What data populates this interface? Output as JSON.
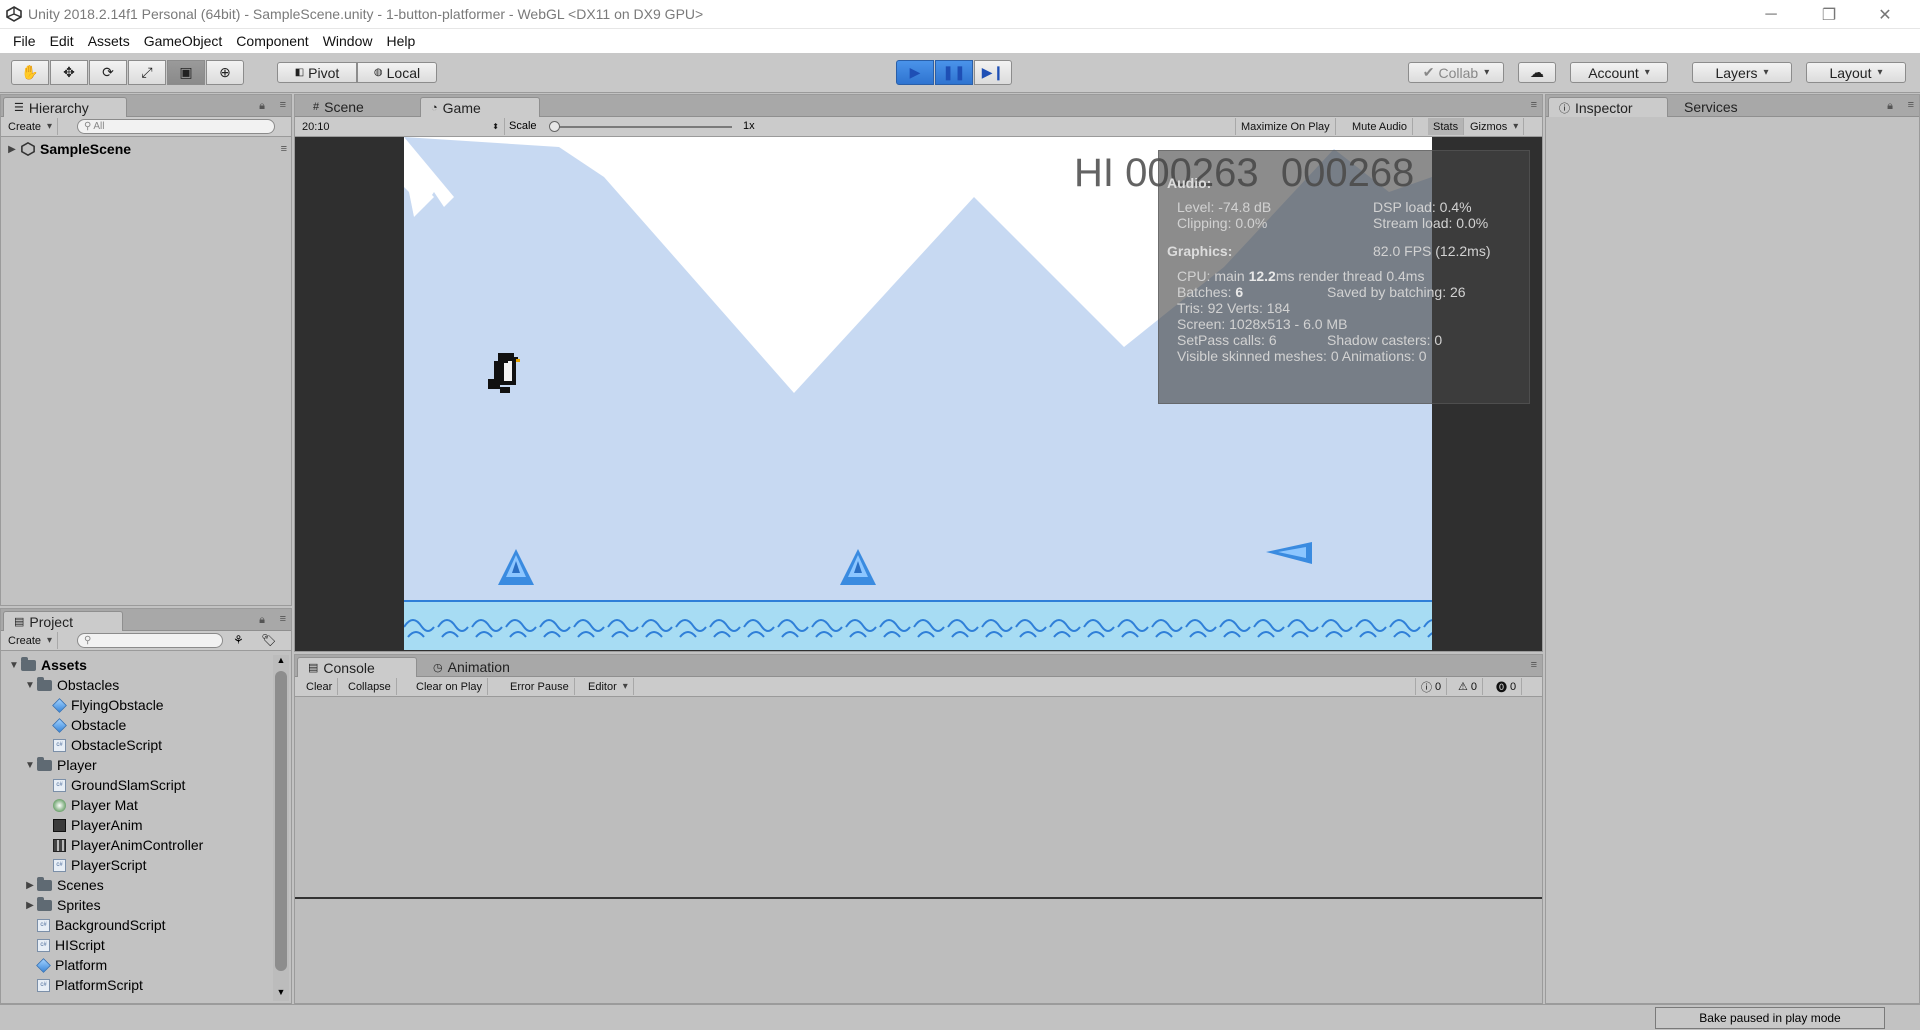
{
  "window": {
    "title": "Unity 2018.2.14f1 Personal (64bit) - SampleScene.unity - 1-button-platformer - WebGL <DX11 on DX9 GPU>"
  },
  "menu": [
    "File",
    "Edit",
    "Assets",
    "GameObject",
    "Component",
    "Window",
    "Help"
  ],
  "toolbar": {
    "tools": [
      "hand-tool",
      "move-tool",
      "rotate-tool",
      "scale-tool",
      "rect-tool",
      "transform-tool"
    ],
    "pivot": "Pivot",
    "local": "Local",
    "collab": "Collab",
    "account": "Account",
    "layers": "Layers",
    "layout": "Layout"
  },
  "hierarchy": {
    "tab": "Hierarchy",
    "create": "Create",
    "search_placeholder": "All",
    "scene": "SampleScene"
  },
  "scene_tabs": {
    "scene": "Scene",
    "game": "Game"
  },
  "game_bar": {
    "aspect": "20:10",
    "scale_label": "Scale",
    "scale_value": "1x",
    "maximize": "Maximize On Play",
    "mute": "Mute Audio",
    "stats": "Stats",
    "gizmos": "Gizmos"
  },
  "game": {
    "hi_score": "HI 000263",
    "score": "000268"
  },
  "stats": {
    "audio_header": "Audio:",
    "level": "Level: -74.8 dB",
    "clipping": "Clipping: 0.0%",
    "dsp": "DSP load: 0.4%",
    "stream": "Stream load: 0.0%",
    "graphics_header": "Graphics:",
    "fps": "82.0 FPS (12.2ms)",
    "cpu_label": "CPU: main",
    "cpu_main": "12.2",
    "cpu_rest": "ms  render thread 0.4ms",
    "batches_label": "Batches:",
    "batches": "6",
    "saved": "Saved by batching: 26",
    "tris": "Tris: 92   Verts: 184",
    "screen": "Screen: 1028x513 - 6.0 MB",
    "setpass": "SetPass calls: 6",
    "shadow": "Shadow casters: 0",
    "skinned": "Visible skinned meshes: 0  Animations: 0"
  },
  "inspector": {
    "tab": "Inspector",
    "services": "Services"
  },
  "project": {
    "tab": "Project",
    "create": "Create",
    "tree": [
      {
        "label": "Assets",
        "depth": 0,
        "kind": "folder",
        "fold": "open",
        "bold": true
      },
      {
        "label": "Obstacles",
        "depth": 1,
        "kind": "folder",
        "fold": "open"
      },
      {
        "label": "FlyingObstacle",
        "depth": 2,
        "kind": "prefab"
      },
      {
        "label": "Obstacle",
        "depth": 2,
        "kind": "prefab"
      },
      {
        "label": "ObstacleScript",
        "depth": 2,
        "kind": "script"
      },
      {
        "label": "Player",
        "depth": 1,
        "kind": "folder",
        "fold": "open"
      },
      {
        "label": "GroundSlamScript",
        "depth": 2,
        "kind": "script"
      },
      {
        "label": "Player Mat",
        "depth": 2,
        "kind": "material"
      },
      {
        "label": "PlayerAnim",
        "depth": 2,
        "kind": "animation"
      },
      {
        "label": "PlayerAnimController",
        "depth": 2,
        "kind": "controller"
      },
      {
        "label": "PlayerScript",
        "depth": 2,
        "kind": "script"
      },
      {
        "label": "Scenes",
        "depth": 1,
        "kind": "folder",
        "fold": "closed"
      },
      {
        "label": "Sprites",
        "depth": 1,
        "kind": "folder",
        "fold": "closed"
      },
      {
        "label": "BackgroundScript",
        "depth": 1,
        "kind": "script"
      },
      {
        "label": "HIScript",
        "depth": 1,
        "kind": "script"
      },
      {
        "label": "Platform",
        "depth": 1,
        "kind": "prefab"
      },
      {
        "label": "PlatformScript",
        "depth": 1,
        "kind": "script"
      }
    ]
  },
  "console": {
    "tab": "Console",
    "animation_tab": "Animation",
    "clear": "Clear",
    "collapse": "Collapse",
    "clear_on_play": "Clear on Play",
    "error_pause": "Error Pause",
    "editor": "Editor",
    "info_count": "0",
    "warn_count": "0",
    "error_count": "0"
  },
  "status": {
    "bake": "Bake paused in play mode"
  },
  "colors": {
    "sky": "#c7d9f2",
    "water": "#a7dcf3",
    "play_blue": "#2f74d0",
    "accent_spike": "#2f7fd8"
  }
}
